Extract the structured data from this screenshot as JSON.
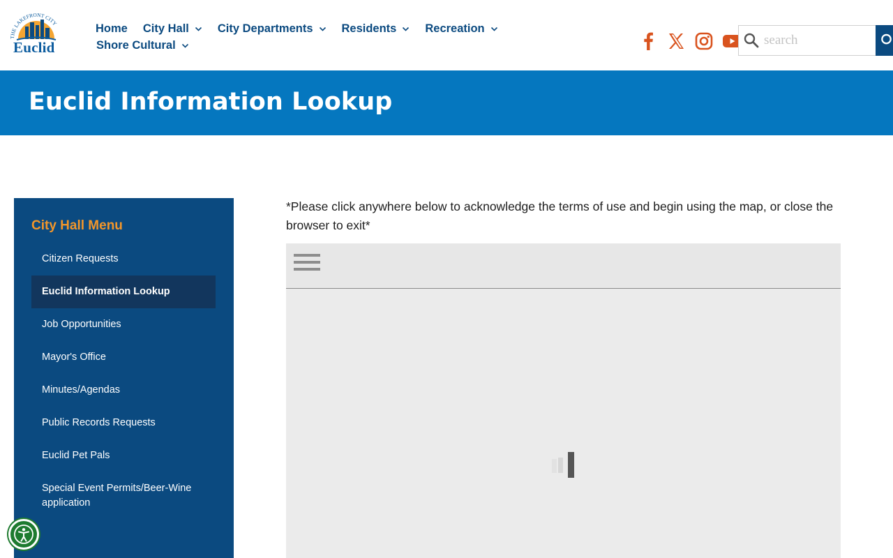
{
  "header": {
    "logo_arc_text": "THE LAKEFRONT CITY",
    "logo_word": "Euclid",
    "nav_row1": [
      {
        "label": "Home",
        "has_dropdown": false
      },
      {
        "label": "City Hall",
        "has_dropdown": true
      },
      {
        "label": "City Departments",
        "has_dropdown": true
      },
      {
        "label": "Residents",
        "has_dropdown": true
      },
      {
        "label": "Recreation",
        "has_dropdown": true
      }
    ],
    "nav_row2": [
      {
        "label": "Shore Cultural",
        "has_dropdown": true
      }
    ],
    "social_icons": [
      "facebook-icon",
      "x-twitter-icon",
      "instagram-icon",
      "youtube-icon"
    ],
    "search": {
      "placeholder": "search"
    }
  },
  "banner": {
    "title": "Euclid Information Lookup"
  },
  "sidebar": {
    "title": "City Hall Menu",
    "items": [
      {
        "label": "Citizen Requests",
        "active": false
      },
      {
        "label": "Euclid Information Lookup",
        "active": true
      },
      {
        "label": "Job Opportunities",
        "active": false
      },
      {
        "label": "Mayor's Office",
        "active": false
      },
      {
        "label": "Minutes/Agendas",
        "active": false
      },
      {
        "label": "Public Records Requests",
        "active": false
      },
      {
        "label": "Euclid Pet Pals",
        "active": false
      },
      {
        "label": "Special Event Permits/Beer-Wine application",
        "active": false
      }
    ]
  },
  "main": {
    "notice": "*Please click anywhere below to acknowledge the terms of use and begin using the map, or close the browser to exit*"
  },
  "colors": {
    "primary_blue": "#0b4a80",
    "banner_blue": "#0577bf",
    "accent_orange": "#f2962a",
    "social_orange": "#d9531e",
    "a11y_green": "#1e7b2f"
  }
}
